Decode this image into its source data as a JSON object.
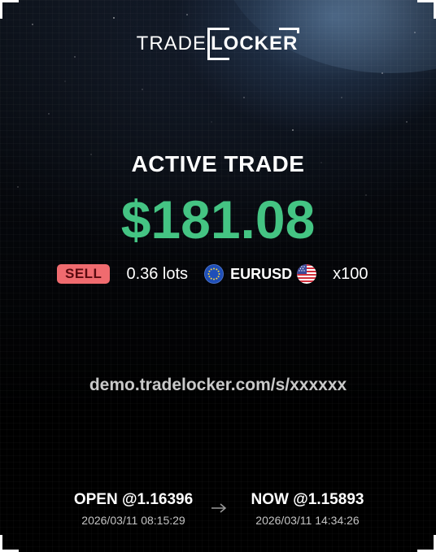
{
  "logo": {
    "trade": "TRADE",
    "locker": "LOCKER"
  },
  "trade": {
    "title": "ACTIVE TRADE",
    "pnl": "$181.08",
    "side": "SELL",
    "lots": "0.36 lots",
    "pair": "EURUSD",
    "base_flag": "eu-flag-icon",
    "quote_flag": "us-flag-icon",
    "leverage": "x100",
    "pnl_color": "#44c483",
    "sell_color": "#f06b6f"
  },
  "share_link": "demo.tradelocker.com/s/xxxxxx",
  "open": {
    "label": "OPEN @1.16396",
    "time": "2026/03/11 08:15:29"
  },
  "now": {
    "label": "NOW @1.15893",
    "time": "2026/03/11 14:34:26"
  }
}
